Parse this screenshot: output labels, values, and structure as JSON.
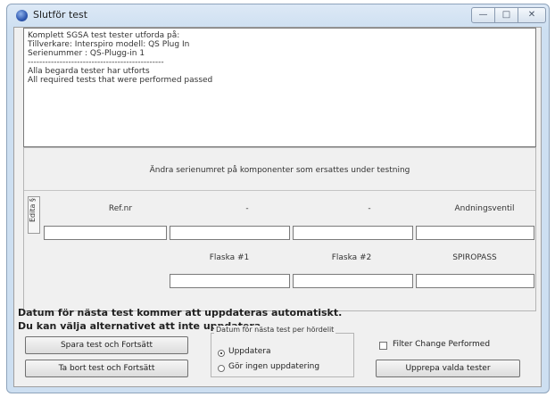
{
  "window": {
    "title": "Slutför test",
    "min_glyph": "—",
    "max_glyph": "□",
    "close_glyph": "✕"
  },
  "log": {
    "lines": [
      "Komplett SGSA test tester utforda på:",
      "Tillverkare: Interspiro modell: QS Plug In",
      "Serienummer : QS-Plugg-in 1",
      "-----------------------------------------------",
      "Alla begarda tester har utforts",
      "All required tests that were performed passed"
    ]
  },
  "components": {
    "instruction": "Ändra serienumret på komponenter som ersattes under testning",
    "tab_label": "Edita §",
    "row1_labels": [
      "Ref.nr",
      "-",
      "-",
      "Andningsventil"
    ],
    "row2_labels": [
      "Flaska #1",
      "Flaska #2",
      "SPIROPASS"
    ]
  },
  "notice": {
    "line1": "Datum för nästa test kommer att uppdateras automatiskt.",
    "line2": "Du kan välja alternativet att inte uppdatera."
  },
  "buttons": {
    "save_continue": "Spara test och Fortsätt",
    "delete_continue": "Ta bort test och Fortsätt",
    "repeat_tests": "Upprepa valda tester"
  },
  "date_group": {
    "title": "Datum för nästa test per hördelit",
    "option_update": "Uppdatera",
    "option_no_update": "Gör ingen uppdatering",
    "selected": "Uppdatera"
  },
  "filter_checkbox": {
    "label": "Filter Change Performed",
    "checked": false
  }
}
